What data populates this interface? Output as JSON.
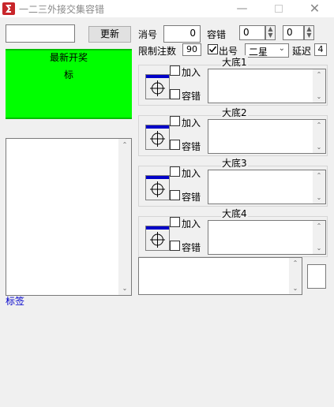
{
  "window": {
    "title": "一二三外接交集容错"
  },
  "toolbar": {
    "update_label": "更新",
    "xiaohao_label": "消号",
    "xiaohao_value": "0",
    "rongcuo_label": "容错",
    "rongcuo_value1": "0",
    "rongcuo_value2": "0",
    "limit_label": "限制注数",
    "limit_value": "90",
    "chuhao_label": "出号",
    "star_value": "二星",
    "delay_label": "延迟",
    "delay_value": "4",
    "search_value": ""
  },
  "banner": {
    "title": "最新开奖",
    "subtitle": "标",
    "color": "#00ff00"
  },
  "groups": [
    {
      "title": "大底1",
      "join_label": "加入",
      "tol_label": "容错"
    },
    {
      "title": "大底2",
      "join_label": "加入",
      "tol_label": "容错"
    },
    {
      "title": "大底3",
      "join_label": "加入",
      "tol_label": "容错"
    },
    {
      "title": "大底4",
      "join_label": "加入",
      "tol_label": "容错"
    }
  ],
  "footer": {
    "label": "标签"
  }
}
